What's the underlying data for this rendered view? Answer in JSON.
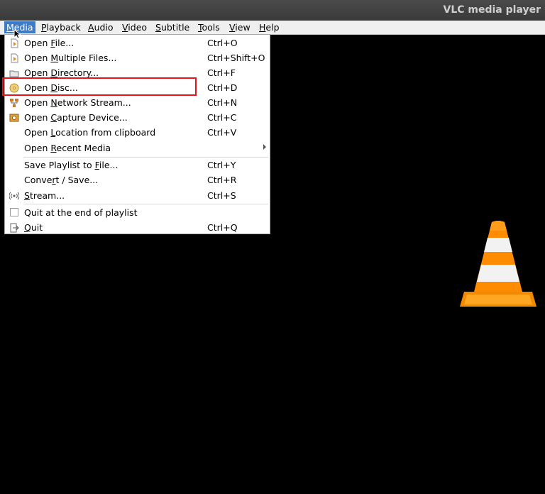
{
  "window": {
    "title": "VLC media player"
  },
  "menubar": [
    {
      "label": "Media",
      "mnemonic": "M",
      "rest": "edia",
      "active": true
    },
    {
      "label": "Playback",
      "mnemonic": "P",
      "rest": "layback"
    },
    {
      "label": "Audio",
      "mnemonic": "A",
      "rest": "udio"
    },
    {
      "label": "Video",
      "mnemonic": "V",
      "rest": "ideo"
    },
    {
      "label": "Subtitle",
      "mnemonic": "S",
      "rest": "ubtitle"
    },
    {
      "label": "Tools",
      "mnemonic": "T",
      "rest": "ools"
    },
    {
      "label": "View",
      "mnemonic": "V",
      "rest": "iew"
    },
    {
      "label": "Help",
      "mnemonic": "H",
      "rest": "elp"
    }
  ],
  "media_menu": {
    "open_file": {
      "pre": "Open ",
      "mn": "F",
      "post": "ile...",
      "shortcut": "Ctrl+O",
      "icon": "open-file-icon"
    },
    "open_multiple": {
      "pre": "Open ",
      "mn": "M",
      "post": "ultiple Files...",
      "shortcut": "Ctrl+Shift+O",
      "icon": "open-multiple-files-icon"
    },
    "open_directory": {
      "pre": "Open ",
      "mn": "D",
      "post": "irectory...",
      "shortcut": "Ctrl+F",
      "icon": "folder-icon"
    },
    "open_disc": {
      "pre": "Open ",
      "mn": "D",
      "post": "isc...",
      "shortcut": "Ctrl+D",
      "icon": "disc-icon"
    },
    "open_network": {
      "pre": "Open ",
      "mn": "N",
      "post": "etwork Stream...",
      "shortcut": "Ctrl+N",
      "icon": "network-icon"
    },
    "open_capture": {
      "pre": "Open ",
      "mn": "C",
      "post": "apture Device...",
      "shortcut": "Ctrl+C",
      "icon": "capture-device-icon"
    },
    "open_location": {
      "pre": "Open ",
      "mn": "L",
      "post": "ocation from clipboard",
      "shortcut": "Ctrl+V"
    },
    "open_recent": {
      "pre": "Open ",
      "mn": "R",
      "post": "ecent Media"
    },
    "save_playlist": {
      "pre": "Save Playlist to ",
      "mn": "F",
      "post": "ile...",
      "shortcut": "Ctrl+Y"
    },
    "convert": {
      "pre": "Conve",
      "mn": "r",
      "post": "t / Save...",
      "shortcut": "Ctrl+R"
    },
    "stream": {
      "pre": "",
      "mn": "S",
      "post": "tream...",
      "shortcut": "Ctrl+S",
      "icon": "stream-icon"
    },
    "quit_end": {
      "label": "Quit at the end of playlist",
      "checked": false
    },
    "quit": {
      "pre": "",
      "mn": "Q",
      "post": "uit",
      "shortcut": "Ctrl+Q",
      "icon": "quit-icon"
    }
  },
  "colors": {
    "menu_highlight": "#3d7bc7",
    "annotation_box": "#e0161c",
    "cone_orange": "#f08a00"
  }
}
